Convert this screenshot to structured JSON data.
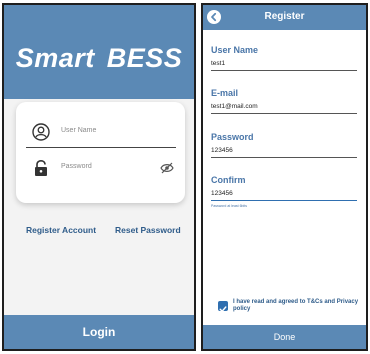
{
  "login": {
    "brand_word1": "Smart",
    "brand_word2": "BESS",
    "username_placeholder": "User Name",
    "password_placeholder": "Password",
    "register_link": "Register Account",
    "reset_link": "Reset Password",
    "login_button": "Login"
  },
  "register": {
    "title": "Register",
    "fields": [
      {
        "label": "User Name",
        "value": "test1"
      },
      {
        "label": "E-mail",
        "value": "test1@mail.com"
      },
      {
        "label": "Password",
        "value": "123456"
      },
      {
        "label": "Confirm",
        "value": "123456",
        "hint": "Password at least 6bits"
      }
    ],
    "agree_text": "I have read and agreed to T&Cs and Privacy policy",
    "done_button": "Done"
  },
  "colors": {
    "primary": "#5b89b5",
    "label_blue": "#4a76a8",
    "accent_blue": "#2f6fb0"
  },
  "icons": {
    "user": "user-circle-icon",
    "lock": "lock-icon",
    "eye_off": "eye-off-icon",
    "back": "back-arrow-icon",
    "checkbox": "checkbox-checked-icon"
  }
}
